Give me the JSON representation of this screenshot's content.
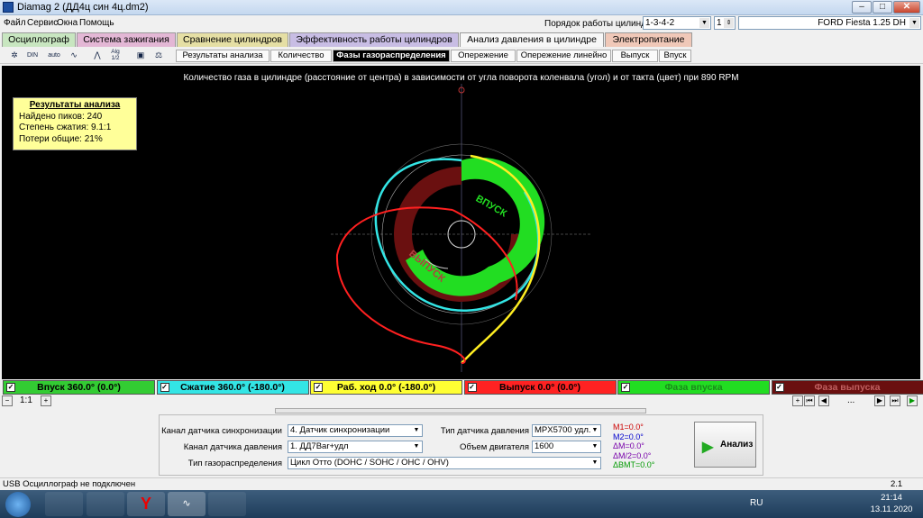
{
  "window": {
    "title": "Diamag 2 (ДД4ц син 4ц.dm2)"
  },
  "menu": [
    "Файл",
    "Сервис",
    "Окна",
    "Помощь"
  ],
  "cylinder_order": {
    "label": "Порядок работы цилиндров",
    "value": "1-3-4-2",
    "cylinder": "1"
  },
  "car": "FORD Fiesta 1.25 DH",
  "tabs": [
    "Осциллограф",
    "Система зажигания",
    "Сравнение цилиндров",
    "Эффективность работы цилиндров",
    "Анализ давления в цилиндре",
    "Электропитание"
  ],
  "subtabs": [
    "Результаты анализа",
    "Количество",
    "Фазы газораспределения",
    "Опережение",
    "Опережение линейно",
    "Выпуск",
    "Впуск"
  ],
  "toolbar_labels": {
    "t2": "DIN",
    "t3": "auto",
    "t5": "Alg 1/2"
  },
  "plot": {
    "title": "Количество газа в цилиндре (расстояние от центра) в зависимости от угла поворота коленвала (угол) и от такта (цвет) при 890 RPM",
    "inlet_label": "ВПУСК",
    "exhaust_label": "ВЫПУСК"
  },
  "results": {
    "title": "Результаты анализа",
    "peaks": "Найдено пиков: 240",
    "compression": "Степень сжатия: 9.1:1",
    "losses": "Потери общие: 21%"
  },
  "legend": [
    {
      "label": "Впуск 360.0° (0.0°)",
      "bg": "#33cc33",
      "fg": "#000000"
    },
    {
      "label": "Сжатие 360.0° (-180.0°)",
      "bg": "#33e5e5",
      "fg": "#000000"
    },
    {
      "label": "Раб. ход 0.0° (-180.0°)",
      "bg": "#ffff33",
      "fg": "#000000"
    },
    {
      "label": "Выпуск 0.0° (0.0°)",
      "bg": "#ff2222",
      "fg": "#000000"
    },
    {
      "label": "Фаза впуска",
      "bg": "#22dd22",
      "fg": "#1a8a1a"
    },
    {
      "label": "Фаза выпуска",
      "bg": "#6a0f0f",
      "fg": "#c06060"
    }
  ],
  "scale": "1:1",
  "scroll_middle": "...",
  "panel": {
    "sync_label": "Канал датчика синхронизации",
    "sync_value": "4.  Датчик синхронизации",
    "pressure_label": "Канал датчика давления",
    "pressure_value": "1.  ДД7Bar+удл",
    "timing_label": "Тип газораспределения",
    "timing_value": "Цикл Отто (DOHC / SOHC / OHC / OHV)",
    "sensor_label": "Тип датчика давления",
    "sensor_value": "MPX5700 удл.",
    "volume_label": "Объем двигателя",
    "volume_value": "1600",
    "analyze": "Анализ"
  },
  "measurements": [
    {
      "text": "M1=0.0°",
      "color": "#cc0000"
    },
    {
      "text": "M2=0.0°",
      "color": "#0000cc"
    },
    {
      "text": "ΔM=0.0°",
      "color": "#7700aa"
    },
    {
      "text": "ΔM/2=0.0°",
      "color": "#7700aa"
    },
    {
      "text": "ΔBMT=0.0°",
      "color": "#009900"
    }
  ],
  "status": {
    "left": "USB Осциллограф не подключен",
    "right": "2.1"
  },
  "tray": {
    "lang": "RU",
    "time": "21:14",
    "date": "13.11.2020"
  }
}
